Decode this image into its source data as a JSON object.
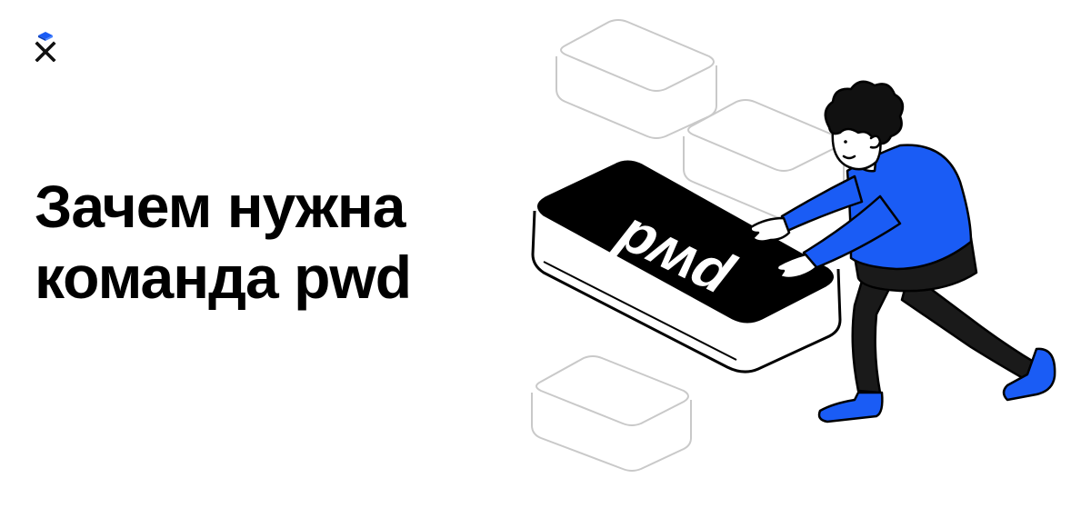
{
  "brand": {
    "logo_icon": "x-logo-icon",
    "accent_color": "#1a5cf5"
  },
  "headline": {
    "line1": "Зачем нужна",
    "line2": "команда pwd",
    "color": "#000000"
  },
  "illustration": {
    "key_label": "pwd",
    "key_color": "#000000",
    "figure_color": "#1a5cf5"
  }
}
